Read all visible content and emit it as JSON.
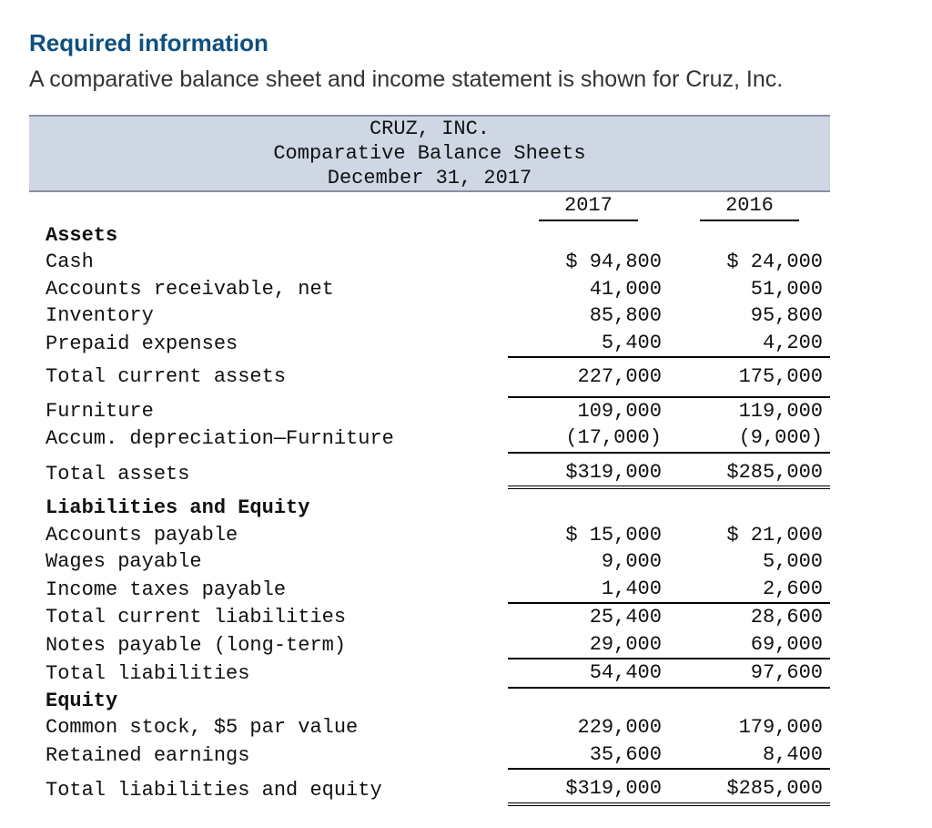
{
  "heading": "Required information",
  "lede": "A comparative balance sheet and income statement is shown for Cruz, Inc.",
  "banner": {
    "company": "CRUZ, INC.",
    "title": "Comparative Balance Sheets",
    "date": "December 31, 2017"
  },
  "years": {
    "y1": "2017",
    "y2": "2016"
  },
  "sections": {
    "assets_hdr": "Assets",
    "liab_hdr": "Liabilities and Equity",
    "equity_hdr": "Equity"
  },
  "rows": {
    "cash": {
      "label": "Cash",
      "y1": "$ 94,800",
      "y2": "$ 24,000"
    },
    "ar": {
      "label": "Accounts receivable, net",
      "y1": "41,000",
      "y2": "51,000"
    },
    "inventory": {
      "label": "Inventory",
      "y1": "85,800",
      "y2": "95,800"
    },
    "prepaid": {
      "label": "Prepaid expenses",
      "y1": "5,400",
      "y2": "4,200"
    },
    "tca": {
      "label": "Total current assets",
      "y1": "227,000",
      "y2": "175,000"
    },
    "furniture": {
      "label": "Furniture",
      "y1": "109,000",
      "y2": "119,000"
    },
    "accdep": {
      "label": "Accum. depreciation—Furniture",
      "y1": "(17,000)",
      "y2": "(9,000)"
    },
    "ta": {
      "label": "Total assets",
      "y1": "$319,000",
      "y2": "$285,000"
    },
    "ap": {
      "label": "Accounts payable",
      "y1": "$ 15,000",
      "y2": "$ 21,000"
    },
    "wages": {
      "label": "Wages payable",
      "y1": "9,000",
      "y2": "5,000"
    },
    "taxes": {
      "label": "Income taxes payable",
      "y1": "1,400",
      "y2": "2,600"
    },
    "tcl": {
      "label": "Total current liabilities",
      "y1": "25,400",
      "y2": "28,600"
    },
    "notes": {
      "label": "Notes payable (long-term)",
      "y1": "29,000",
      "y2": "69,000"
    },
    "tl": {
      "label": "Total liabilities",
      "y1": "54,400",
      "y2": "97,600"
    },
    "common": {
      "label": "Common stock, $5 par value",
      "y1": "229,000",
      "y2": "179,000"
    },
    "re": {
      "label": "Retained earnings",
      "y1": "35,600",
      "y2": "8,400"
    },
    "tle": {
      "label": "Total liabilities and equity",
      "y1": "$319,000",
      "y2": "$285,000"
    }
  }
}
